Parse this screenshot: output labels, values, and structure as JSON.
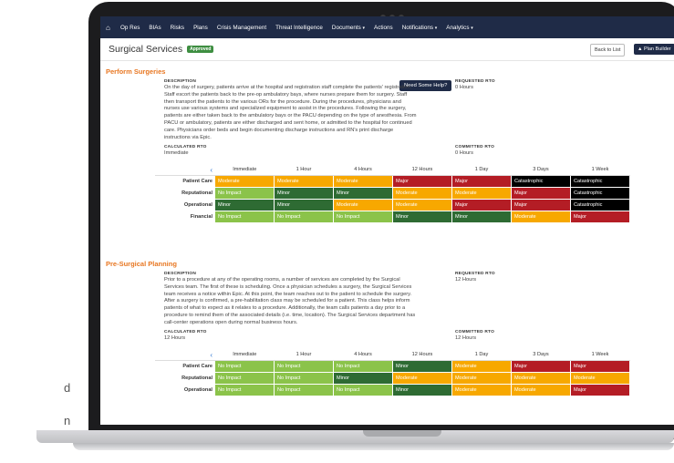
{
  "side_text": [
    "d",
    "n"
  ],
  "nav": {
    "home_icon": "home-icon",
    "items": [
      "Op Res",
      "BIAs",
      "Risks",
      "Plans",
      "Crisis Management",
      "Threat Intelligence",
      "Documents",
      "Actions",
      "Notifications",
      "Analytics"
    ]
  },
  "header": {
    "title": "Surgical Services",
    "badge": "Approved",
    "back_label": "Back to List",
    "plan_label": "Plan Builder",
    "help_label": "Need Some Help?"
  },
  "sections": [
    {
      "title": "Perform Surgeries",
      "desc_label": "DESCRIPTION",
      "desc_lines": [
        "On the day of surgery, patients arrive at the hospital and registration staff complete the patients' registration.",
        "Staff escort the patients back to the pre-op ambulatory bays, where nurses prepare them for surgery. Staff",
        "then transport the patients to the various ORs for the procedure. During the procedures, physicians and",
        "nurses use various systems and specialized equipment to assist in the procedures. Following the surgery,",
        "patients are either taken back to the ambulatory bays or the PACU depending on the type of anesthesia. From",
        "PACU or ambulatory, patients are either discharged and sent home, or admitted to the hospital for continued",
        "care. Physicians order beds and begin documenting discharge instructions and RN's print discharge",
        "instructions via Epic."
      ],
      "req_label": "REQUESTED RTO",
      "req_value": "0 Hours",
      "calc_label": "CALCULATED RTO",
      "calc_value": "Immediate",
      "com_label": "COMMITTED RTO",
      "com_value": "0 Hours",
      "columns": [
        "Immediate",
        "1 Hour",
        "4 Hours",
        "12 Hours",
        "1 Day",
        "3 Days",
        "1 Week"
      ],
      "rows": [
        {
          "label": "Patient Care",
          "cells": [
            "Moderate",
            "Moderate",
            "Moderate",
            "Major",
            "Major",
            "Catastrophic",
            "Catastrophic"
          ]
        },
        {
          "label": "Reputational",
          "cells": [
            "No Impact",
            "Minor",
            "Minor",
            "Moderate",
            "Moderate",
            "Major",
            "Catastrophic"
          ]
        },
        {
          "label": "Operational",
          "cells": [
            "Minor",
            "Minor",
            "Moderate",
            "Moderate",
            "Major",
            "Major",
            "Catastrophic"
          ]
        },
        {
          "label": "Financial",
          "cells": [
            "No Impact",
            "No Impact",
            "No Impact",
            "Minor",
            "Minor",
            "Moderate",
            "Major"
          ]
        }
      ]
    },
    {
      "title": "Pre-Surgical Planning",
      "desc_label": "DESCRIPTION",
      "desc_lines": [
        "Prior to a procedure at any of the operating rooms, a number of services are completed by the Surgical",
        "Services team. The first of these is scheduling. Once a physician schedules a surgery, the Surgical Services",
        "team receives a notice within Epic. At this point, the team reaches out to the patient to schedule the surgery.",
        "After a surgery is confirmed, a pre-habilitation class may be scheduled for a patient. This class helps inform",
        "patients of what to expect as it relates to a procedure. Additionally, the team calls patients a day prior to a",
        "procedure to remind them of the associated details (i.e. time, location). The Surgical Services department has",
        "call-center operations open during normal business hours."
      ],
      "req_label": "REQUESTED RTO",
      "req_value": "12 Hours",
      "calc_label": "CALCULATED RTO",
      "calc_value": "12 Hours",
      "com_label": "COMMITTED RTO",
      "com_value": "12 Hours",
      "columns": [
        "Immediate",
        "1 Hour",
        "4 Hours",
        "12 Hours",
        "1 Day",
        "3 Days",
        "1 Week"
      ],
      "rows": [
        {
          "label": "Patient Care",
          "cells": [
            "No Impact",
            "No Impact",
            "No Impact",
            "Minor",
            "Moderate",
            "Major",
            "Major"
          ]
        },
        {
          "label": "Reputational",
          "cells": [
            "No Impact",
            "No Impact",
            "Minor",
            "Moderate",
            "Moderate",
            "Moderate",
            "Moderate"
          ]
        },
        {
          "label": "Operational",
          "cells": [
            "No Impact",
            "No Impact",
            "No Impact",
            "Minor",
            "Moderate",
            "Moderate",
            "Major"
          ]
        }
      ]
    }
  ]
}
